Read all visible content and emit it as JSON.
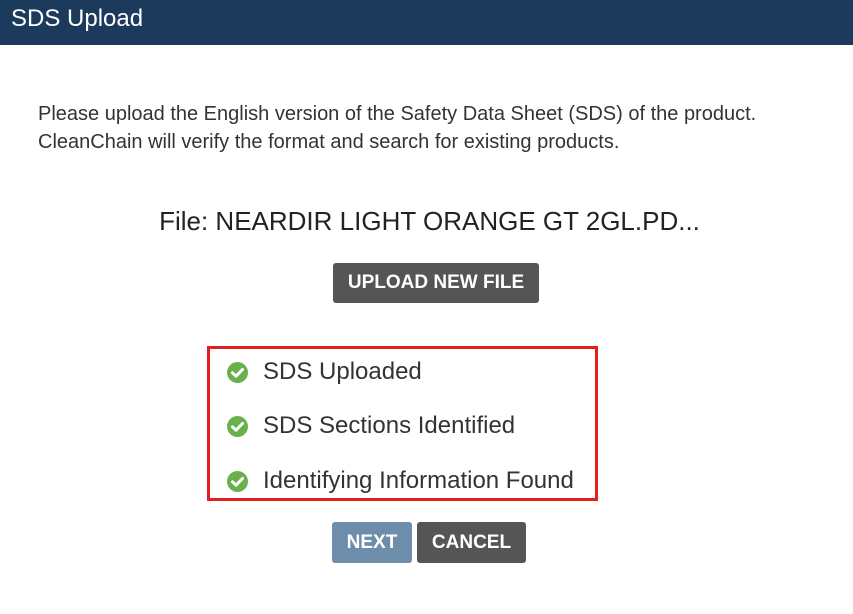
{
  "header": {
    "title": "SDS Upload"
  },
  "instructions": "Please upload the English version of the Safety Data Sheet (SDS) of the product. CleanChain will verify the format and search for existing products.",
  "file": {
    "label": "File: NEARDIR LIGHT ORANGE GT 2GL.PD..."
  },
  "buttons": {
    "upload_new_file": "UPLOAD NEW FILE",
    "next": "NEXT",
    "cancel": "CANCEL"
  },
  "status_items": [
    {
      "label": "SDS Uploaded",
      "icon": "check-circle-icon",
      "state": "complete"
    },
    {
      "label": "SDS Sections Identified",
      "icon": "check-circle-icon",
      "state": "complete"
    },
    {
      "label": "Identifying Information Found",
      "icon": "check-circle-icon",
      "state": "complete"
    }
  ],
  "colors": {
    "header_bg": "#1b3a5c",
    "check_green": "#6ab04c",
    "highlight_border": "#e41e1e",
    "next_button": "#6d8dab",
    "dark_button": "#555555"
  }
}
